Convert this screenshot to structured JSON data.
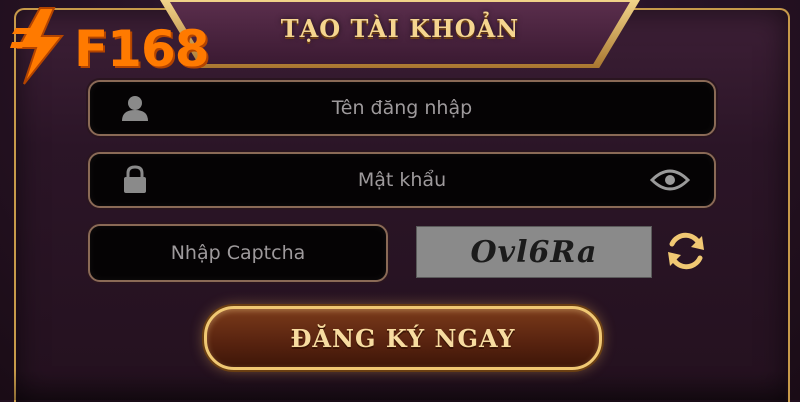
{
  "brand": {
    "logo_text": "F168",
    "accent_color": "#ff7a00",
    "logo_icon": "lightning-bolt-icon"
  },
  "header": {
    "title": "TẠO TÀI KHOẢN"
  },
  "form": {
    "username": {
      "placeholder": "Tên đăng nhập",
      "icon": "user-icon"
    },
    "password": {
      "placeholder": "Mật khẩu",
      "icon": "lock-icon",
      "toggle_icon": "eye-icon"
    },
    "captcha": {
      "placeholder": "Nhập Captcha",
      "code": "Ovl6Ra",
      "refresh_icon": "refresh-icon"
    },
    "submit_label": "ĐĂNG KÝ NGAY"
  },
  "colors": {
    "gold": "#f0c873",
    "panel_bg": "#2b1527",
    "field_bg": "#050304"
  }
}
